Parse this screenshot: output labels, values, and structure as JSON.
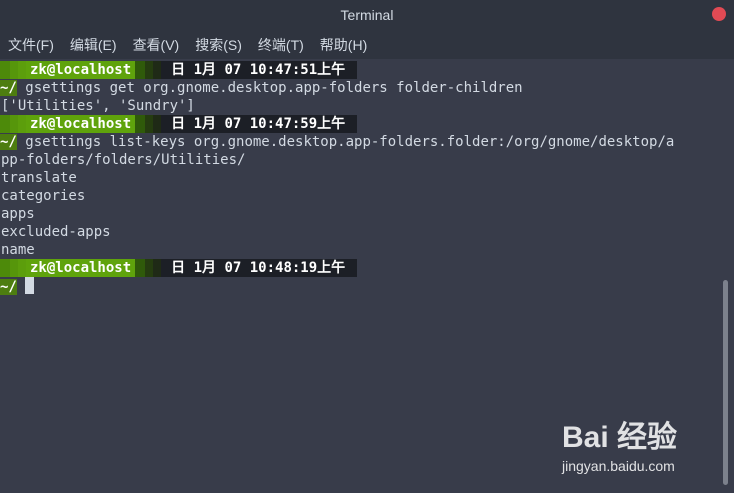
{
  "window": {
    "title": "Terminal"
  },
  "menu": [
    "文件(F)",
    "编辑(E)",
    "查看(V)",
    "搜索(S)",
    "终端(T)",
    "帮助(H)"
  ],
  "prompts": [
    {
      "user": "zk@localhost",
      "time": "日 1月 07 10:47:51上午"
    },
    {
      "user": "zk@localhost",
      "time": "日 1月 07 10:47:59上午"
    },
    {
      "user": "zk@localhost",
      "time": "日 1月 07 10:48:19上午"
    }
  ],
  "cwd": "~/",
  "commands": [
    "gsettings get org.gnome.desktop.app-folders folder-children",
    "gsettings list-keys org.gnome.desktop.app-folders.folder:/org/gnome/desktop/a",
    "pp-folders/folders/Utilities/"
  ],
  "output1": "['Utilities', 'Sundry']",
  "output2": [
    "translate",
    "categories",
    "apps",
    "excluded-apps",
    "name"
  ],
  "watermark": {
    "logo": "Bai 经验",
    "url": "jingyan.baidu.com"
  },
  "colors": {
    "prompt_green": "#5fa30c",
    "terminal_bg": "#383c4a",
    "close": "#e14a54"
  }
}
